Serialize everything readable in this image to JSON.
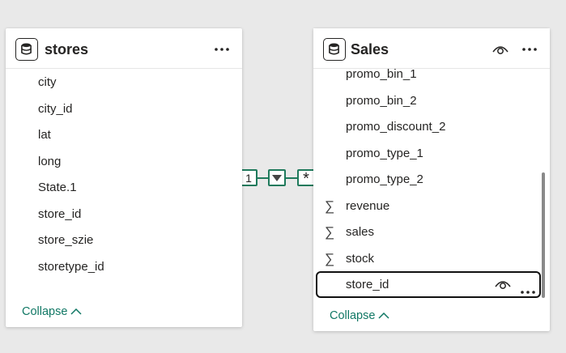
{
  "stores_card": {
    "title": "stores",
    "fields": [
      "city",
      "city_id",
      "lat",
      "long",
      "State.1",
      "store_id",
      "store_szie",
      "storetype_id"
    ],
    "collapse_label": "Collapse"
  },
  "sales_card": {
    "title": "Sales",
    "fields": [
      {
        "label": "promo_bin_1",
        "sigma": ""
      },
      {
        "label": "promo_bin_2",
        "sigma": ""
      },
      {
        "label": "promo_discount_2",
        "sigma": ""
      },
      {
        "label": "promo_type_1",
        "sigma": ""
      },
      {
        "label": "promo_type_2",
        "sigma": ""
      },
      {
        "label": "revenue",
        "sigma": "∑"
      },
      {
        "label": "sales",
        "sigma": "∑"
      },
      {
        "label": "stock",
        "sigma": "∑"
      },
      {
        "label": "store_id",
        "sigma": ""
      }
    ],
    "selected_field": "store_id",
    "collapse_label": "Collapse"
  },
  "relationship": {
    "one_side": "1",
    "many_side": "*",
    "direction_icon": "triangle-down-icon"
  },
  "icons": {
    "table": "table-icon",
    "more": "more-options-icon",
    "eye": "eye-icon",
    "chevron_up": "chevron-up-icon",
    "sigma": "sigma-icon"
  },
  "colors": {
    "canvas": "#e9e9e9",
    "card": "#ffffff",
    "accent_green": "#117865",
    "relationship_line": "#1f7a5c"
  }
}
